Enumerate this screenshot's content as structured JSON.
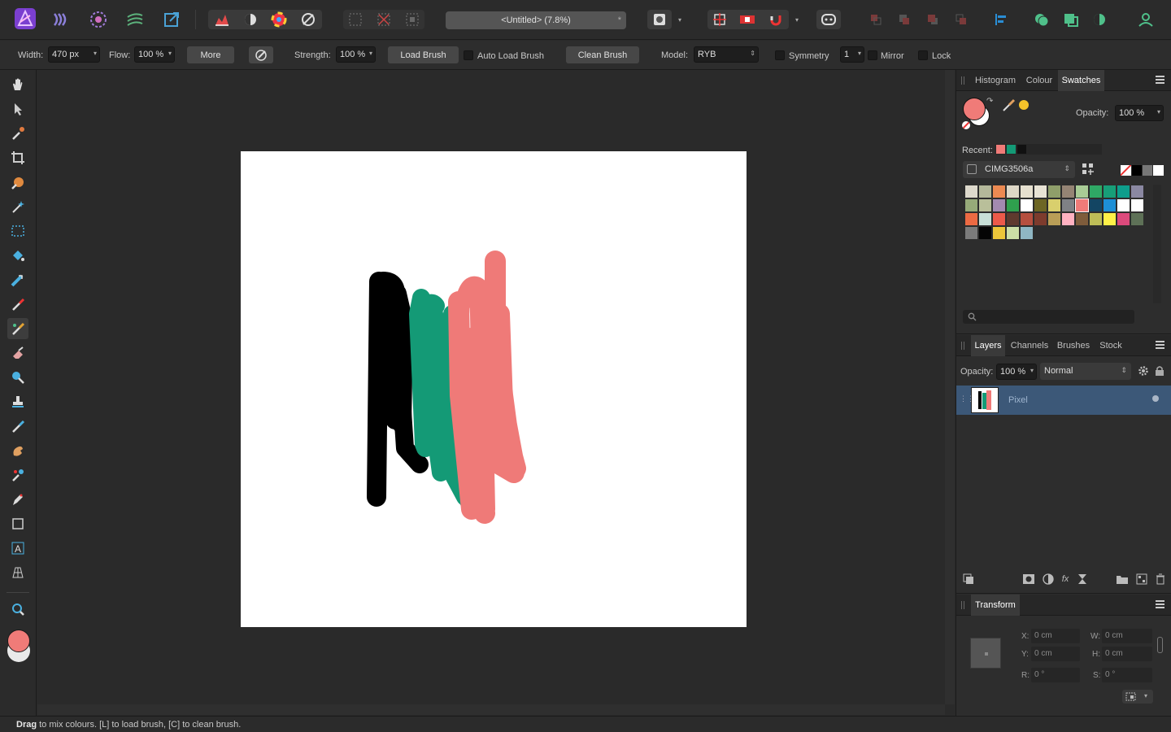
{
  "app": {
    "title": "<Untitled> (7.8%)",
    "modified_marker": "*"
  },
  "context_toolbar": {
    "width_label": "Width:",
    "width_value": "470 px",
    "flow_label": "Flow:",
    "flow_value": "100 %",
    "more_label": "More",
    "strength_label": "Strength:",
    "strength_value": "100 %",
    "load_brush_label": "Load Brush",
    "auto_load_label": "Auto Load Brush",
    "clean_brush_label": "Clean Brush",
    "model_label": "Model:",
    "model_value": "RYB",
    "symmetry_label": "Symmetry",
    "symmetry_count": "1",
    "mirror_label": "Mirror",
    "lock_label": "Lock"
  },
  "colour_panel": {
    "tabs": [
      "Histogram",
      "Colour",
      "Swatches"
    ],
    "active_tab": "Swatches",
    "opacity_label": "Opacity:",
    "opacity_value": "100 %",
    "recent_label": "Recent:",
    "recent": [
      "#f07b78",
      "#149a76",
      "#111111"
    ],
    "palette_name": "CIMG3506a",
    "primary_colour": "#f07b78",
    "swatches": [
      [
        "#ddd9cc",
        "#b4b89a",
        "#ec8a52",
        "#ddd7c6",
        "#e6e0cf",
        "#e8e3d5",
        "#8f9e6a",
        "#958474",
        "#a9cc96",
        "#2fa865",
        "#179e78",
        "#0e9e8c",
        "#8b88a2"
      ],
      [
        "#96aa79",
        "#b9bf9a",
        "#a38ab0",
        "#2fa04e",
        "#ffffff",
        "#6d6624",
        "#d9cf6d",
        "#7f8185",
        "#f07b78",
        "#134563",
        "#1e8fd6",
        "#ffffff",
        "#ffffff"
      ],
      [
        "#ec6a43",
        "#c8dfd7",
        "#ec5a4a",
        "#5e3a2e",
        "#b64f3f",
        "#7d3b2d",
        "#b99e57",
        "#ffb1c1",
        "#7e5c3b",
        "#bdbd57",
        "#fff148",
        "#dc4a7c",
        "#5e7157"
      ],
      [
        "#7b7b7b",
        "#050505",
        "#ecc63a",
        "#ccdfa6",
        "#8fb6c3"
      ]
    ]
  },
  "layers_panel": {
    "tabs": [
      "Layers",
      "Channels",
      "Brushes",
      "Stock"
    ],
    "active_tab": "Layers",
    "opacity_label": "Opacity:",
    "opacity_value": "100 %",
    "blend_mode": "Normal",
    "layers": [
      {
        "name": "Pixel"
      }
    ]
  },
  "transform_panel": {
    "title": "Transform",
    "x_label": "X:",
    "x_value": "0 cm",
    "y_label": "Y:",
    "y_value": "0 cm",
    "w_label": "W:",
    "w_value": "0 cm",
    "h_label": "H:",
    "h_value": "0 cm",
    "r_label": "R:",
    "r_value": "0 °",
    "s_label": "S:",
    "s_value": "0 °"
  },
  "status": {
    "bold": "Drag",
    "text": " to mix colours. [L] to load brush, [C] to clean brush."
  },
  "colors": {
    "accent": "#2a8dd4",
    "layer_selected": "#3c5878",
    "paint_black": "#000000",
    "paint_green": "#149a76",
    "paint_pink": "#ef7a78"
  }
}
